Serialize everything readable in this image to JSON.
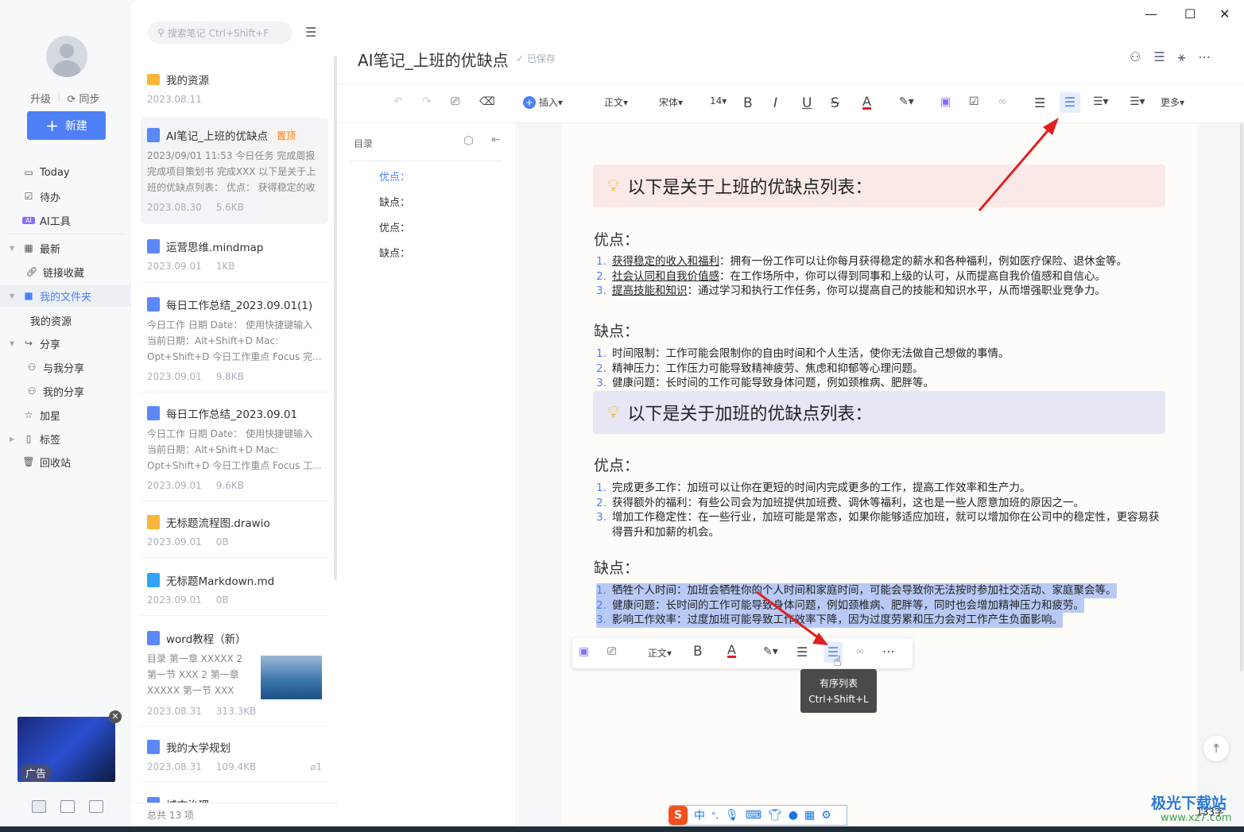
{
  "window": {
    "minimize": "—",
    "maximize": "☐",
    "close": "✕"
  },
  "sidebar": {
    "upgrade": "升级",
    "sync": "同步",
    "new_button": "新建",
    "items": [
      {
        "label": "Today",
        "icon": "calendar-icon"
      },
      {
        "label": "待办",
        "icon": "checkbox-icon"
      },
      {
        "label": "AI工具",
        "icon": "ai-icon"
      },
      {
        "label": "最新",
        "icon": "grid-icon"
      },
      {
        "label": "链接收藏",
        "icon": "link-icon"
      },
      {
        "label": "我的文件夹",
        "icon": "folder-icon"
      },
      {
        "label": "我的资源",
        "icon": ""
      },
      {
        "label": "分享",
        "icon": "share-icon"
      },
      {
        "label": "与我分享",
        "icon": "user-icon"
      },
      {
        "label": "我的分享",
        "icon": "user-icon"
      },
      {
        "label": "加星",
        "icon": "star-icon"
      },
      {
        "label": "标签",
        "icon": "tag-icon"
      },
      {
        "label": "回收站",
        "icon": "trash-icon"
      }
    ],
    "ad_label": "广告"
  },
  "notes": {
    "search_placeholder": "搜索笔记 Ctrl+Shift+F",
    "items": [
      {
        "title": "我的资源",
        "date": "2023.08.11",
        "size": "",
        "type": "folder"
      },
      {
        "title": "AI笔记_上班的优缺点",
        "badge": "置顶",
        "snippet": "2023/09/01 11:53 今日任务 完成周报 完成项目策划书 完成XXX 以下是关于上班的优缺点列表： 优点： 获得稳定的收入...",
        "date": "2023.08.30",
        "size": "5.6KB",
        "type": "doc"
      },
      {
        "title": "运营思维.mindmap",
        "date": "2023.09.01",
        "size": "1KB",
        "type": "mindmap"
      },
      {
        "title": "每日工作总结_2023.09.01(1)",
        "snippet": "今日工作 日期 Date： 使用快捷键输入 当前日期：Alt+Shift+D Mac: Opt+Shift+D 今日工作重点 Focus 完...",
        "date": "2023.09.01",
        "size": "9.8KB",
        "type": "doc"
      },
      {
        "title": "每日工作总结_2023.09.01",
        "snippet": "今日工作 日期 Date： 使用快捷键输入 当前日期：Alt+Shift+D Mac: Opt+Shift+D 今日工作重点 Focus 工...",
        "date": "2023.09.01",
        "size": "9.6KB",
        "type": "doc"
      },
      {
        "title": "无标题流程图.drawio",
        "date": "2023.09.01",
        "size": "0B",
        "type": "drawio"
      },
      {
        "title": "无标题Markdown.md",
        "date": "2023.09.01",
        "size": "0B",
        "type": "md"
      },
      {
        "title": "word教程（新）",
        "snippet": "目录 第一章 XXXXX 2 第一节 XXX 2 第一章 XXXXX 第一节 XXX 视...",
        "date": "2023.08.31",
        "size": "313.3KB",
        "type": "doc"
      },
      {
        "title": "我的大学规划",
        "date": "2023.08.31",
        "size": "109.4KB",
        "attachments": "1",
        "type": "doc"
      },
      {
        "title": "城市治理",
        "type": "doc"
      }
    ],
    "total": "总共 13 项"
  },
  "doc": {
    "title": "AI笔记_上班的优缺点",
    "saved": "已保存",
    "toolbar": {
      "insert": "插入",
      "style": "正文",
      "font": "宋体",
      "size": "14",
      "more": "更多",
      "bold": "B",
      "italic": "I",
      "underline": "U",
      "strike": "S",
      "color": "A"
    },
    "toc": {
      "label": "目录",
      "items": [
        "优点：",
        "缺点：",
        "优点：",
        "缺点："
      ]
    },
    "sections": [
      {
        "callout": "以下是关于上班的优缺点列表：",
        "callout_color": "#fbe9e8",
        "pros_title": "优点：",
        "pros": [
          {
            "term": "获得稳定的收入和福利",
            "text": "：拥有一份工作可以让你每月获得稳定的薪水和各种福利，例如医疗保险、退休金等。"
          },
          {
            "term": "社会认同和自我价值感",
            "text": "：在工作场所中，你可以得到同事和上级的认可，从而提高自我价值感和自信心。"
          },
          {
            "term": "提高技能和知识",
            "text": "：通过学习和执行工作任务，你可以提高自己的技能和知识水平，从而增强职业竞争力。"
          }
        ],
        "cons_title": "缺点：",
        "cons": [
          "时间限制：工作可能会限制你的自由时间和个人生活，使你无法做自己想做的事情。",
          "精神压力：工作压力可能导致精神疲劳、焦虑和抑郁等心理问题。",
          "健康问题：长时间的工作可能导致身体问题，例如颈椎病、肥胖等。"
        ]
      },
      {
        "callout": "以下是关于加班的优缺点列表：",
        "callout_color": "#e6e6f5",
        "pros_title": "优点：",
        "pros": [
          "完成更多工作：加班可以让你在更短的时间内完成更多的工作，提高工作效率和生产力。",
          "获得额外的福利：有些公司会为加班提供加班费、调休等福利，这也是一些人愿意加班的原因之一。",
          "增加工作稳定性：在一些行业，加班可能是常态，如果你能够适应加班，就可以增加你在公司中的稳定性，更容易获得晋升和加薪的机会。"
        ],
        "cons_title": "缺点：",
        "cons": [
          "牺牲个人时间：加班会牺牲你的个人时间和家庭时间，可能会导致你无法按时参加社交活动、家庭聚会等。",
          "健康问题：长时间的工作可能导致身体问题，例如颈椎病、肥胖等，同时也会增加精神压力和疲劳。",
          "影响工作效率：过度加班可能导致工作效率下降，因为过度劳累和压力会对工作产生负面影响。"
        ]
      }
    ],
    "float_toolbar": {
      "style": "正文",
      "bold": "B",
      "color": "A"
    },
    "tooltip": {
      "title": "有序列表",
      "shortcut": "Ctrl+Shift+L"
    },
    "word_count": "133字"
  },
  "ime": {
    "mode": "中",
    "punct": "°,"
  },
  "watermark": {
    "name": "极光下载站",
    "url": "www.xz7.com"
  },
  "colors": {
    "accent": "#4e7ff5",
    "arrow": "#e02020",
    "selection": "#b9c9f5"
  }
}
